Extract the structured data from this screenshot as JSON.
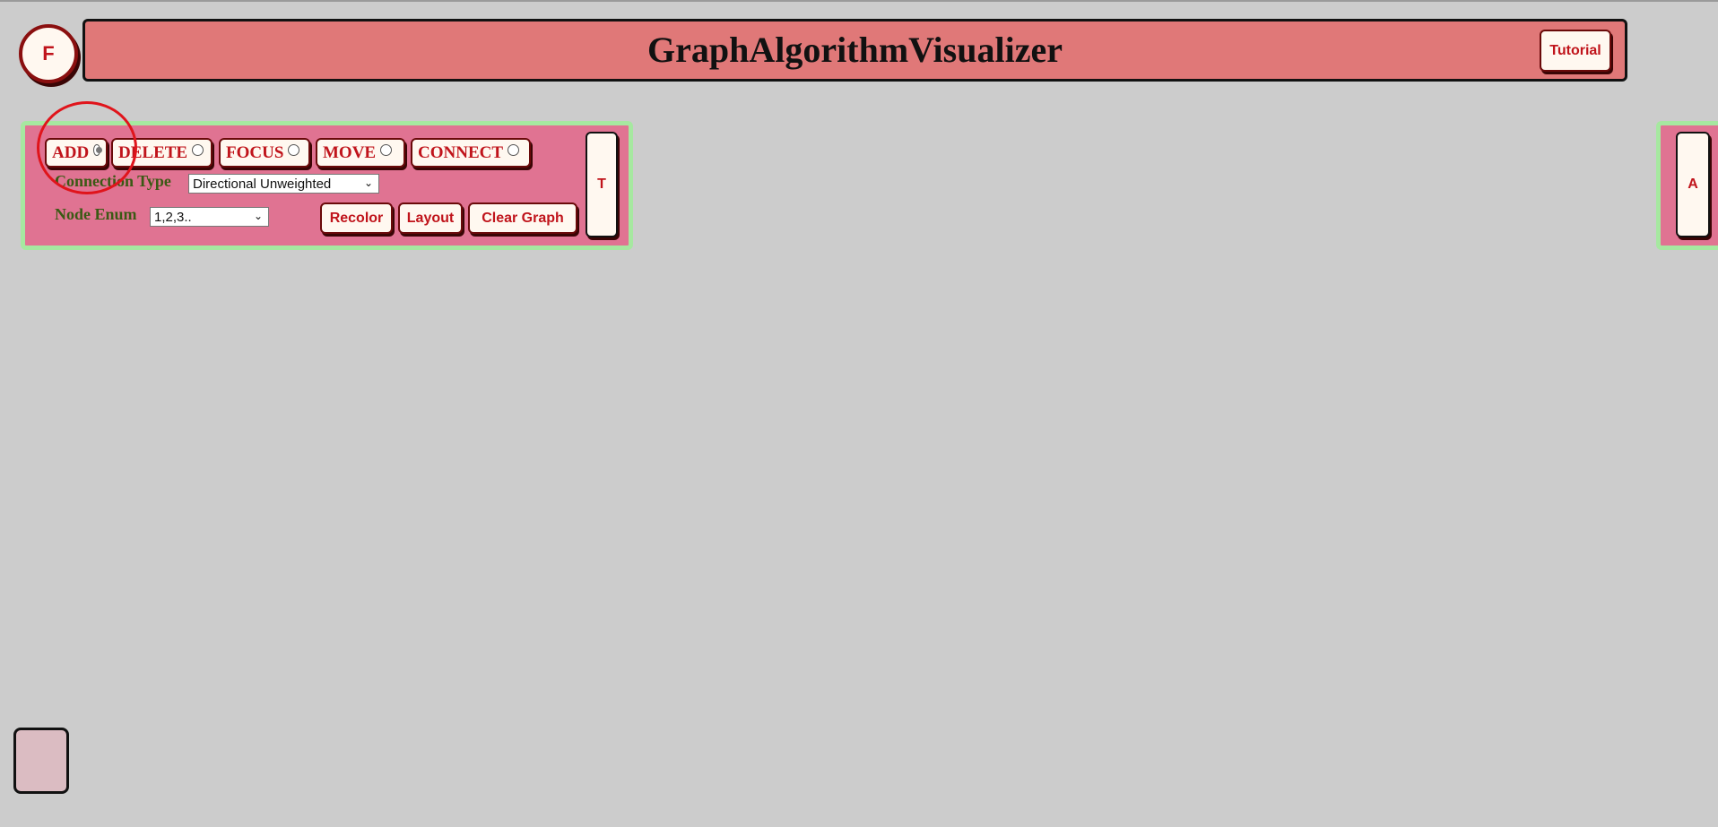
{
  "app": {
    "title": "GraphAlgorithmVisualizer",
    "f_button_label": "F",
    "tutorial_label": "Tutorial"
  },
  "toolbar": {
    "modes": [
      {
        "label": "ADD",
        "selected": true
      },
      {
        "label": "DELETE",
        "selected": false
      },
      {
        "label": "FOCUS",
        "selected": false
      },
      {
        "label": "MOVE",
        "selected": false
      },
      {
        "label": "CONNECT",
        "selected": false
      }
    ],
    "connection_type_label": "Connection Type",
    "connection_type_value": "Directional Unweighted",
    "node_enum_label": "Node Enum",
    "node_enum_value": "1,2,3..",
    "recolor_label": "Recolor",
    "layout_label": "Layout",
    "clear_graph_label": "Clear Graph",
    "t_button_label": "T"
  },
  "right_panel": {
    "a_button_label": "A"
  },
  "colors": {
    "background": "#cccccc",
    "header": "#e07878",
    "toolbar": "#e07392",
    "toolbar_border": "#a6e8a0",
    "accent_text": "#c0141b",
    "label_text": "#3a5a14",
    "highlight": "#e0141b"
  }
}
